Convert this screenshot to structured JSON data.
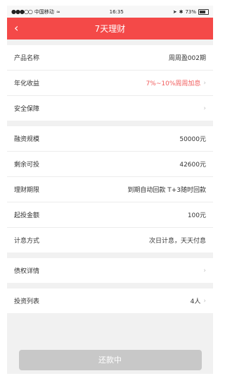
{
  "status": {
    "carrier": "中国移动",
    "time": "16:35",
    "battery": "73%"
  },
  "nav": {
    "back": "‹",
    "title": "7天理财"
  },
  "group1": [
    {
      "label": "产品名称",
      "value": "周周盈002期",
      "chevron": false,
      "red": false
    },
    {
      "label": "年化收益",
      "value": "7%~10%周周加息",
      "chevron": true,
      "red": true
    },
    {
      "label": "安全保障",
      "value": "",
      "chevron": true,
      "red": false
    }
  ],
  "group2": [
    {
      "label": "融资规模",
      "value": "50000元",
      "chevron": false
    },
    {
      "label": "剩余可投",
      "value": "42600元",
      "chevron": false
    },
    {
      "label": "理财期限",
      "value": "到期自动回款 T+3随时回款",
      "chevron": false
    },
    {
      "label": "起投金额",
      "value": "100元",
      "chevron": false
    },
    {
      "label": "计息方式",
      "value": "次日计息，天天付息",
      "chevron": false
    }
  ],
  "group3": [
    {
      "label": "债权详情",
      "value": "",
      "chevron": true
    }
  ],
  "group4": [
    {
      "label": "投资列表",
      "value": "4人",
      "chevron": true
    }
  ],
  "footer": {
    "button": "还款中"
  }
}
